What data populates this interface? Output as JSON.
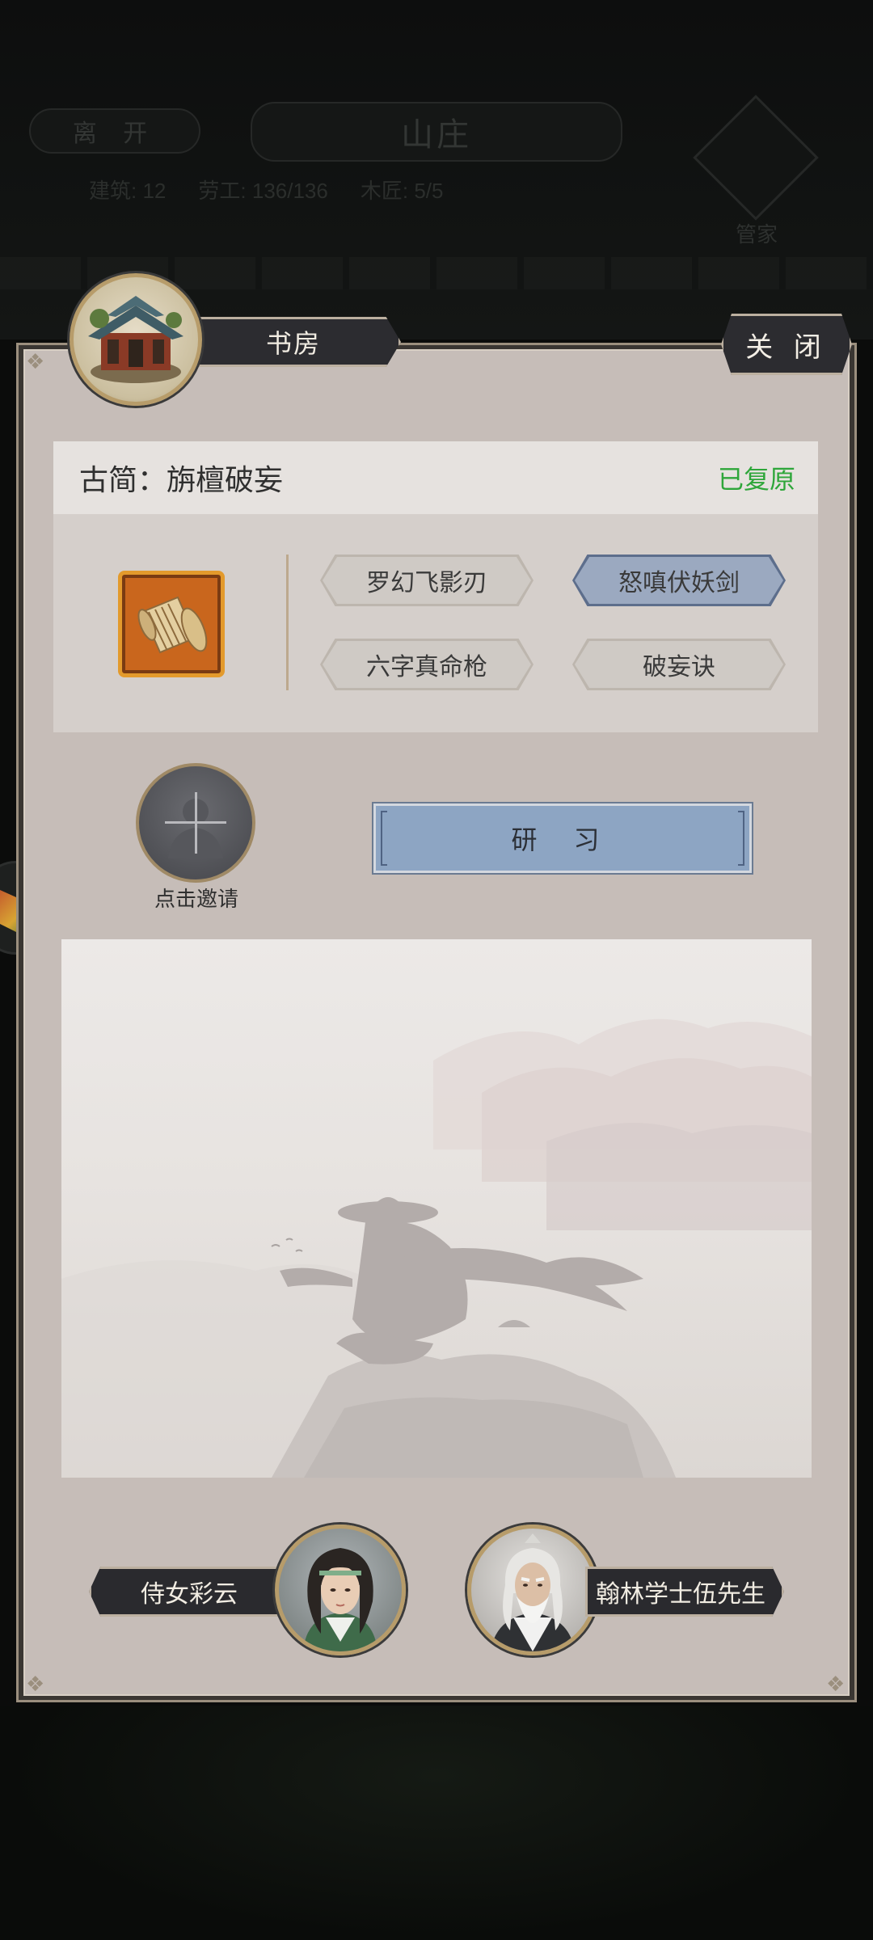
{
  "background": {
    "leave_label": "离 开",
    "estate_title": "山庄",
    "stats": [
      {
        "label": "建筑:",
        "value": "12"
      },
      {
        "label": "劳工:",
        "value": "136/136"
      },
      {
        "label": "木匠:",
        "value": "5/5"
      }
    ],
    "steward_label": "管家"
  },
  "panel": {
    "building_name": "书房",
    "close_label": "关 闭",
    "scroll": {
      "title": "古简：旃檀破妄",
      "status": "已复原",
      "skills": [
        {
          "label": "罗幻飞影刃",
          "selected": false
        },
        {
          "label": "怒嗔伏妖剑",
          "selected": true
        },
        {
          "label": "六字真命枪",
          "selected": false
        },
        {
          "label": "破妄诀",
          "selected": false
        }
      ]
    },
    "invite_label": "点击邀请",
    "study_label": "研 习"
  },
  "npcs": [
    {
      "name": "侍女彩云"
    },
    {
      "name": "翰林学士伍先生"
    }
  ],
  "colors": {
    "status_green": "#2ea63a",
    "selected_skill": "#9ba9c0",
    "study_button": "#8da5c3",
    "panel_bg": "#c6bdb8"
  }
}
